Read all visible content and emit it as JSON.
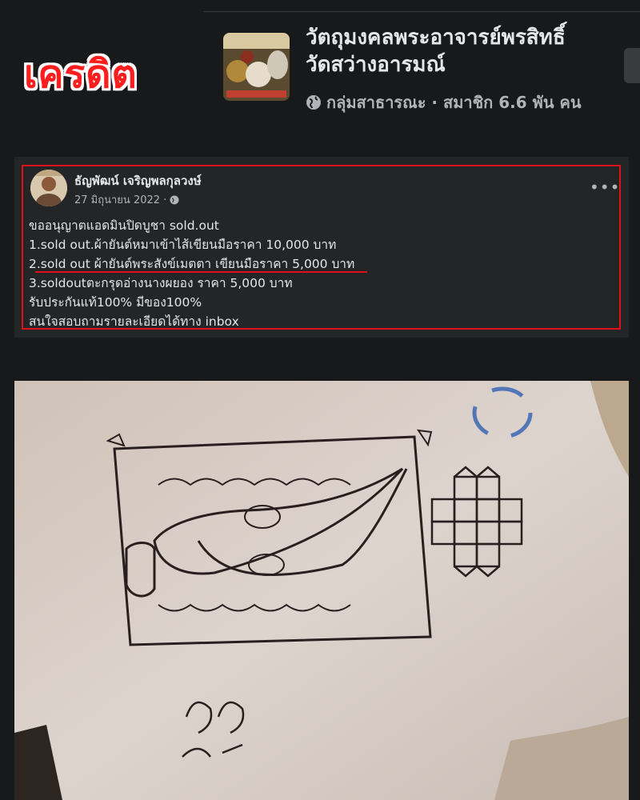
{
  "credit_label": "เครดิต",
  "group": {
    "title_line1": "วัตถุมงคลพระอาจารย์พรสิทธิ์",
    "title_line2": "วัดสว่างอารมณ์",
    "meta": "กลุ่มสาธารณะ · สมาชิก 6.6 พัน คน",
    "globe_icon": "globe-icon"
  },
  "post": {
    "author": "ธัญพัฒน์ เจริญพลกุลวงษ์",
    "date": "27 มิถุนายน 2022 ·",
    "privacy_icon": "globe-icon",
    "more_label": "•••",
    "lines": [
      "ขออนุญาตแอดมินปิดบูชา sold.out",
      "1.sold out.ผ้ายันต์หมาเข้าไส้เขียนมือราคา 10,000 บาท",
      "2.sold out ผ้ายันต์พระสังข์เมตตา เขียนมือราคา 5,000 บาท",
      "3.soldoutตะกรุดอ่างนางผยอง ราคา 5,000 บาท",
      "รับประกันแท้100% มีของ100%",
      "สนใจสอบถามรายละเอียดได้ทาง inbox"
    ]
  },
  "colors": {
    "background": "#18191a",
    "card": "#242526",
    "highlight_red": "#e0101a"
  }
}
